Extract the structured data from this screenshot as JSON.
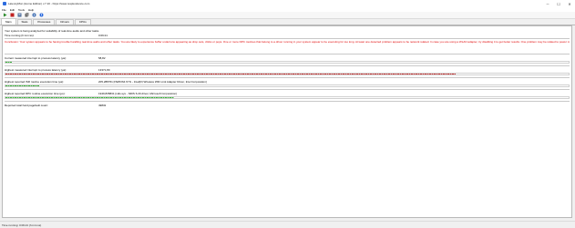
{
  "window": {
    "title": "LatencyMon (Home Edition) v.7.10 - https://www.resplendence.com",
    "minimize": "─",
    "maximize": "☐",
    "close": "✕"
  },
  "menu": [
    "File",
    "Edit",
    "Tools",
    "Help"
  ],
  "toolbar": {
    "icons": [
      "start-icon",
      "stop-icon",
      "report-icon",
      "copy-icon",
      "settings-icon",
      "help-icon"
    ],
    "colors": [
      "#2a8a2a",
      "#c02020",
      "#4a6a9a",
      "#5a5a5a",
      "#3a6ab0",
      "#2d6cdf"
    ]
  },
  "tabs": [
    "Main",
    "Stats",
    "Processes",
    "Drivers",
    "CPUs"
  ],
  "main": {
    "status_line": "Your system is being analyzed for suitability of real-time audio and other tasks.",
    "time_label": "Time running (h:mm:ss):",
    "time_value": "0:09:21",
    "conclusion": "Conclusion: Your system appears to be having trouble handling real-time audio and other tasks. You are likely to experience buffer underruns appearing as drop outs, clicks or pops. One or more DPC routines that belong to a driver running in your system appear to be executing for too long. At least one detected problem appears to be network related. In case you are using a WLAN adapter, try disabling it to get better results. One problem may be related to power management, disable CPU throttling settings in Control Panel and BIOS setup. Check for BIOS updates.",
    "metrics": [
      {
        "label": "Current measured interrupt to process latency (µs):",
        "value": "58,82",
        "fill": 0.012,
        "color": "#3cb43c"
      },
      {
        "label": "Highest measured interrupt to process latency (µs):",
        "value": "13371,80",
        "fill": 0.8,
        "color": "#c83232"
      },
      {
        "label": "Highest reported ISR routine execution time (µs):",
        "value": "205,288761 [NWIFI64.SYS - Intel(R) Wireless WiFi Link Adapter Driver, Intel Corporation]",
        "fill": 0.06,
        "color": "#3cb43c"
      },
      {
        "label": "Highest reported DPC routine execution time (µs):",
        "value": "1949,835831 [ndis.sys - NDIS 6.20 driver, Microsoft Corporation]",
        "fill": 0.3,
        "color": "#3cb43c"
      },
      {
        "label": "Reported total hard pagefault count:",
        "value": "49832",
        "fill": null,
        "color": null
      }
    ]
  },
  "statusbar": {
    "text": "Time running: 0:09:21 (h:mm:ss)"
  }
}
